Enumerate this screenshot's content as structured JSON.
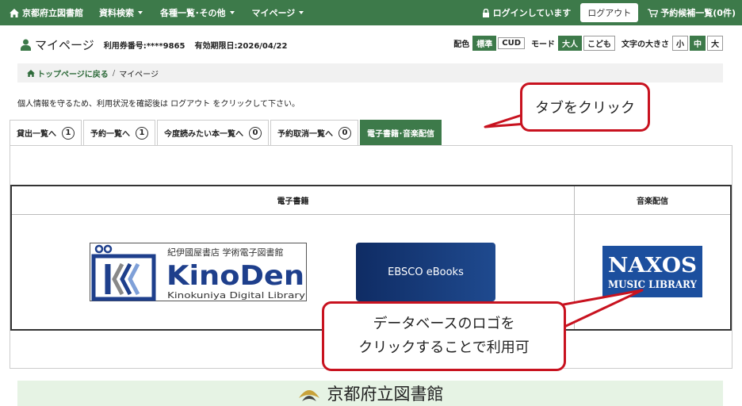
{
  "topbar": {
    "brand": "京都府立図書館",
    "nav": [
      "資料検索",
      "各種一覧･その他",
      "マイページ"
    ],
    "login_status": "ログインしています",
    "logout_button": "ログアウト",
    "reserve_list": "予約候補一覧(0件)"
  },
  "header": {
    "title": "マイページ",
    "card_number": "利用券番号:****9865",
    "expiry": "有効期限日:2026/04/22"
  },
  "settings": {
    "color_label": "配色",
    "color_options": [
      "標準",
      "CUD"
    ],
    "mode_label": "モード",
    "mode_options": [
      "大人",
      "こども"
    ],
    "size_label": "文字の大きさ",
    "size_options": [
      "小",
      "中",
      "大"
    ]
  },
  "breadcrumb": {
    "home": "トップページに戻る",
    "current": "マイページ"
  },
  "notice": "個人情報を守るため、利用状況を確認後は ログアウト をクリックして下さい。",
  "tabs": [
    {
      "label": "貸出一覧へ",
      "count": "1"
    },
    {
      "label": "予約一覧へ",
      "count": "1"
    },
    {
      "label": "今度読みたい本一覧へ",
      "count": "0"
    },
    {
      "label": "予約取消一覧へ",
      "count": "0"
    },
    {
      "label": "電子書籍･音楽配信",
      "count": null
    }
  ],
  "table": {
    "ebooks_header": "電子書籍",
    "music_header": "音楽配信"
  },
  "logos": {
    "kinoden_top": "紀伊國屋書店 学術電子図書館",
    "kinoden_main": "KinoDen",
    "kinoden_sub": "Kinokuniya Digital Library",
    "ebsco": "EBSCO eBooks",
    "naxos_main": "NAXOS",
    "naxos_sub": "MUSIC LIBRARY"
  },
  "callouts": {
    "tab_hint": "タブをクリック",
    "logo_hint_line1": "データベースのロゴを",
    "logo_hint_line2": "クリックすることで利用可"
  },
  "footer": {
    "name": "京都府立図書館"
  },
  "colors": {
    "green": "#3d7a4a",
    "callout_red": "#c8121f",
    "ebsco_blue": "#0f2c64",
    "naxos_blue": "#1c4f9e",
    "kinoden_blue": "#1e3f8c"
  }
}
